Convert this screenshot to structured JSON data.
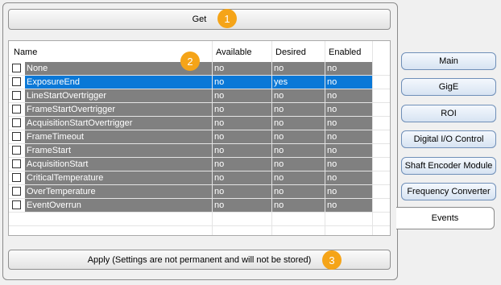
{
  "get_button": {
    "label": "Get",
    "badge": "1"
  },
  "grid": {
    "badge": "2",
    "columns": [
      "Name",
      "Available",
      "Desired",
      "Enabled"
    ],
    "rows": [
      {
        "name": "None",
        "available": "no",
        "desired": "no",
        "enabled": "no",
        "selected": false
      },
      {
        "name": "ExposureEnd",
        "available": "no",
        "desired": "yes",
        "enabled": "no",
        "selected": true
      },
      {
        "name": "LineStartOvertrigger",
        "available": "no",
        "desired": "no",
        "enabled": "no",
        "selected": false
      },
      {
        "name": "FrameStartOvertrigger",
        "available": "no",
        "desired": "no",
        "enabled": "no",
        "selected": false
      },
      {
        "name": "AcquisitionStartOvertrigger",
        "available": "no",
        "desired": "no",
        "enabled": "no",
        "selected": false
      },
      {
        "name": "FrameTimeout",
        "available": "no",
        "desired": "no",
        "enabled": "no",
        "selected": false
      },
      {
        "name": "FrameStart",
        "available": "no",
        "desired": "no",
        "enabled": "no",
        "selected": false
      },
      {
        "name": "AcquisitionStart",
        "available": "no",
        "desired": "no",
        "enabled": "no",
        "selected": false
      },
      {
        "name": "CriticalTemperature",
        "available": "no",
        "desired": "no",
        "enabled": "no",
        "selected": false
      },
      {
        "name": "OverTemperature",
        "available": "no",
        "desired": "no",
        "enabled": "no",
        "selected": false
      },
      {
        "name": "EventOverrun",
        "available": "no",
        "desired": "no",
        "enabled": "no",
        "selected": false
      }
    ]
  },
  "apply_button": {
    "label": "Apply (Settings are not permanent and will not be stored)",
    "badge": "3"
  },
  "tabs": [
    {
      "label": "Main",
      "active": false
    },
    {
      "label": "GigE",
      "active": false
    },
    {
      "label": "ROI",
      "active": false
    },
    {
      "label": "Digital I/O Control",
      "active": false
    },
    {
      "label": "Shaft Encoder Module",
      "active": false
    },
    {
      "label": "Frequency Converter",
      "active": false
    },
    {
      "label": "Events",
      "active": true
    }
  ],
  "colors": {
    "selection": "#0a78d7",
    "row_fill": "#808080",
    "badge": "#f5a418"
  }
}
